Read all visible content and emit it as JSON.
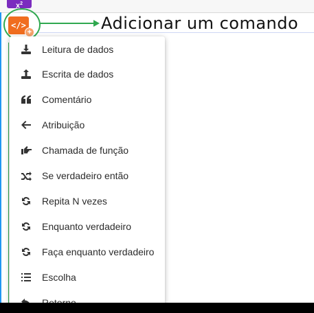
{
  "toolbar": {
    "power_button": {
      "base": "x",
      "exp": "2",
      "icon": "power-icon"
    },
    "command_button": {
      "label": "</>",
      "icon": "code-icon",
      "badge": "+"
    }
  },
  "annotation": {
    "text": "Adicionar um comando"
  },
  "colors": {
    "command_button": "#f06d1f",
    "power_button": "#7b2cbf",
    "annotation": "#2fa84f"
  },
  "menu": {
    "items": [
      {
        "label": "Leitura de dados",
        "icon": "download-icon"
      },
      {
        "label": "Escrita de dados",
        "icon": "upload-icon"
      },
      {
        "label": "Comentário",
        "icon": "quote-icon"
      },
      {
        "label": "Atribuição",
        "icon": "arrow-left-icon"
      },
      {
        "label": "Chamada de função",
        "icon": "hand-pointer-icon"
      },
      {
        "label": "Se verdadeiro então",
        "icon": "shuffle-icon"
      },
      {
        "label": "Repita N vezes",
        "icon": "sync-icon"
      },
      {
        "label": "Enquanto verdadeiro",
        "icon": "sync-icon"
      },
      {
        "label": "Faça enquanto verdadeiro",
        "icon": "sync-icon"
      },
      {
        "label": "Escolha",
        "icon": "list-icon"
      },
      {
        "label": "Retorno",
        "icon": "reply-icon"
      }
    ]
  }
}
